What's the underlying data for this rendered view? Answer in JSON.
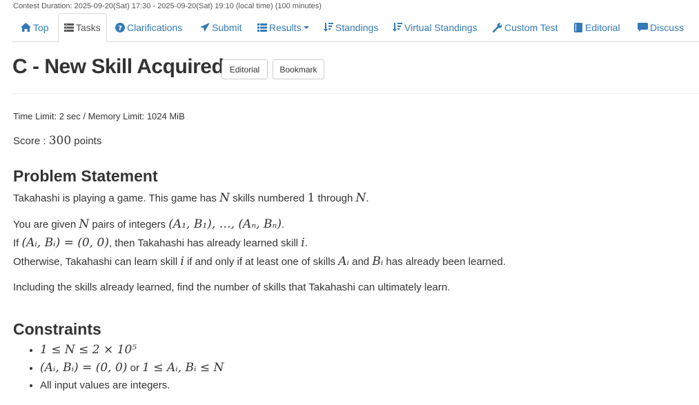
{
  "contest": {
    "duration": "Contest Duration: 2025-09-20(Sat) 17:30 - 2025-09-20(Sat) 19:10 (local time) (100 minutes)"
  },
  "nav": {
    "top": "Top",
    "tasks": "Tasks",
    "clarifications": "Clarifications",
    "submit": "Submit",
    "results": "Results",
    "standings": "Standings",
    "virtual_standings": "Virtual Standings",
    "custom_test": "Custom Test",
    "editorial": "Editorial",
    "discuss": "Discuss"
  },
  "task": {
    "title": "C - New Skill Acquired",
    "editorial_btn": "Editorial",
    "bookmark_btn": "Bookmark",
    "limits": "Time Limit: 2 sec / Memory Limit: 1024 MiB",
    "score_label": "Score : ",
    "score_value": "300",
    "score_unit": " points"
  },
  "statement": {
    "heading": "Problem Statement",
    "p1_a": "Takahashi is playing a game. This game has ",
    "p1_N": "N",
    "p1_b": " skills numbered ",
    "p1_one": "1",
    "p1_c": " through ",
    "p1_N2": "N",
    "p1_d": ".",
    "p2_a": "You are given ",
    "p2_N": "N",
    "p2_b": " pairs of integers ",
    "p2_math": "(A₁, B₁), …, (Aₙ, Bₙ)",
    "p2_c": ".",
    "p3_a": "If ",
    "p3_math": "(Aᵢ, Bᵢ) = (0, 0)",
    "p3_b": ", then Takahashi has already learned skill ",
    "p3_i": "i",
    "p3_c": ".",
    "p4_a": "Otherwise, Takahashi can learn skill ",
    "p4_i": "i",
    "p4_b": " if and only if at least one of skills ",
    "p4_A": "Aᵢ",
    "p4_c": " and ",
    "p4_B": "Bᵢ",
    "p4_d": " has already been learned.",
    "p5": "Including the skills already learned, find the number of skills that Takahashi can ultimately learn."
  },
  "constraints": {
    "heading": "Constraints",
    "c1": "1 ≤ N ≤ 2 × 10⁵",
    "c2_a": "(Aᵢ, Bᵢ) = (0, 0)",
    "c2_or": " or ",
    "c2_b": "1 ≤ Aᵢ, Bᵢ ≤ N",
    "c3": "All input values are integers."
  }
}
